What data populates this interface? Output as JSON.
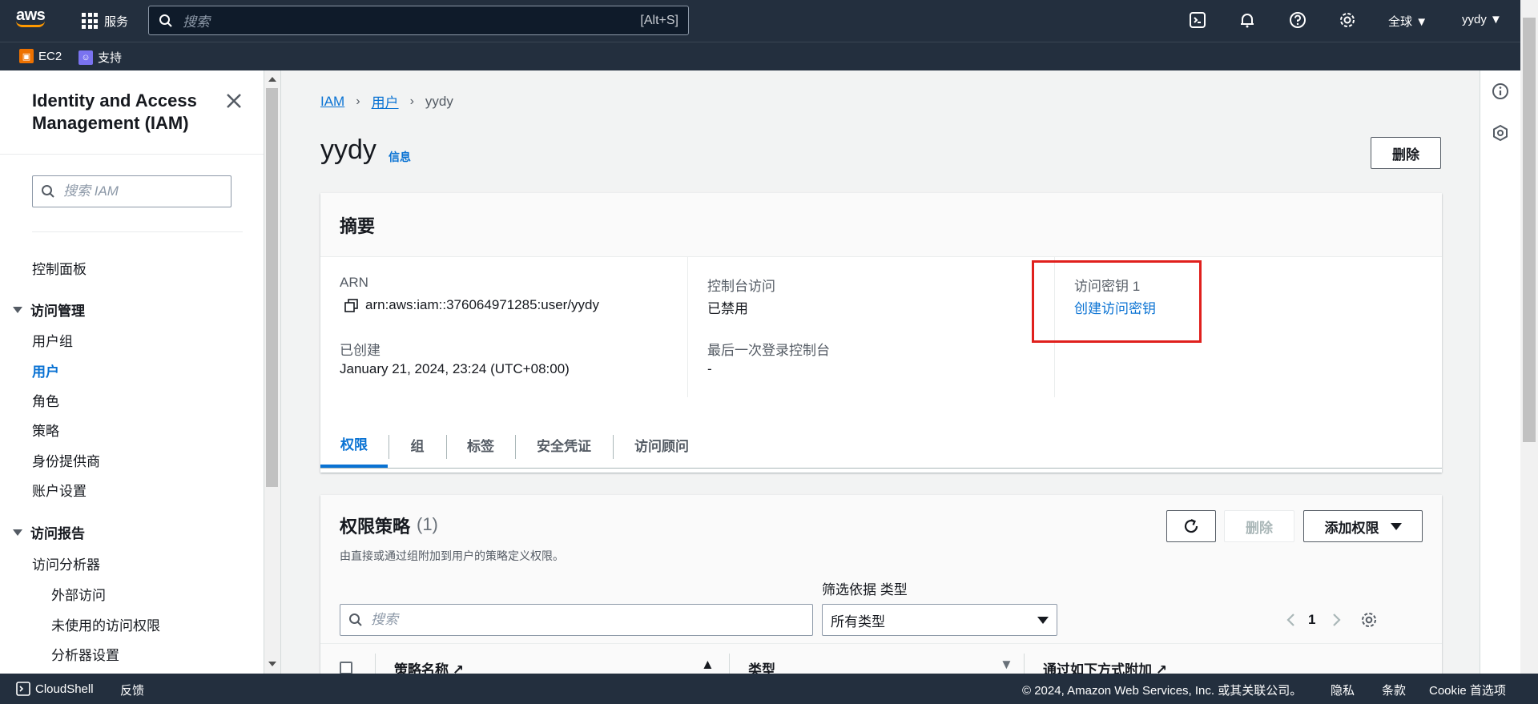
{
  "topnav": {
    "logo_text": "aws",
    "services_label": "服务",
    "search_placeholder": "搜索",
    "search_shortcut": "[Alt+S]",
    "region_label": "全球",
    "account_label": "yydy"
  },
  "favorites": [
    {
      "label": "EC2",
      "icon": "ec2-icon",
      "color": "#ed7100"
    },
    {
      "label": "支持",
      "icon": "support-icon",
      "color": "#7a73f0"
    }
  ],
  "sidebar": {
    "title": "Identity and Access Management (IAM)",
    "search_placeholder": "搜索 IAM",
    "dashboard": "控制面板",
    "access_management": {
      "label": "访问管理",
      "items": [
        "用户组",
        "用户",
        "角色",
        "策略",
        "身份提供商",
        "账户设置"
      ],
      "active": "用户"
    },
    "access_reports": {
      "label": "访问报告",
      "items": [
        "访问分析器"
      ],
      "subitems": [
        "外部访问",
        "未使用的访问权限",
        "分析器设置"
      ]
    }
  },
  "breadcrumb": [
    "IAM",
    "用户",
    "yydy"
  ],
  "page": {
    "title": "yydy",
    "info_link": "信息",
    "delete_button": "删除"
  },
  "summary": {
    "title": "摘要",
    "arn_label": "ARN",
    "arn_value": "arn:aws:iam::376064971285:user/yydy",
    "created_label": "已创建",
    "created_value": "January 21, 2024, 23:24 (UTC+08:00)",
    "console_access_label": "控制台访问",
    "console_access_value": "已禁用",
    "last_login_label": "最后一次登录控制台",
    "last_login_value": "-",
    "access_key_label": "访问密钥 1",
    "create_access_key_link": "创建访问密钥"
  },
  "tabs": [
    "权限",
    "组",
    "标签",
    "安全凭证",
    "访问顾问"
  ],
  "active_tab": "权限",
  "permissions": {
    "title": "权限策略",
    "count": "(1)",
    "description": "由直接或通过组附加到用户的策略定义权限。",
    "delete_button": "删除",
    "add_button": "添加权限",
    "filter_label": "筛选依据 类型",
    "search_placeholder": "搜索",
    "type_select_value": "所有类型",
    "page_number": "1",
    "columns": [
      "策略名称",
      "类型",
      "通过如下方式附加"
    ]
  },
  "footer": {
    "cloudshell": "CloudShell",
    "feedback": "反馈",
    "copyright": "© 2024, Amazon Web Services, Inc. 或其关联公司。",
    "privacy": "隐私",
    "terms": "条款",
    "cookie": "Cookie 首选项"
  },
  "colors": {
    "nav_bg": "#232f3e",
    "link": "#0972d3",
    "highlight": "#e0201d",
    "brand": "#ff9900"
  }
}
